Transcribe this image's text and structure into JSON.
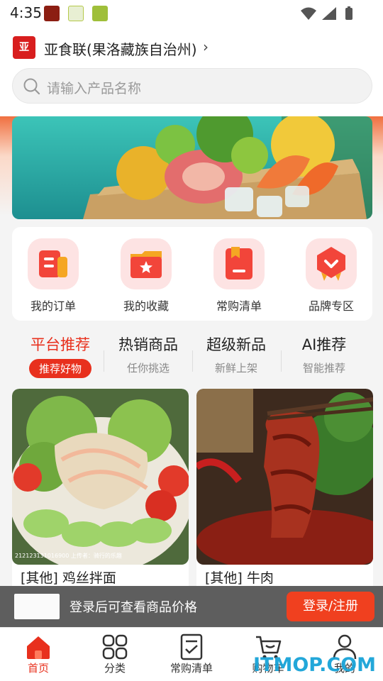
{
  "status_bar": {
    "time": "4:35"
  },
  "header": {
    "logo_text": "亚",
    "store_name": "亚食联(果洛藏族自治州)",
    "chevron": "›"
  },
  "search": {
    "placeholder": "请输入产品名称"
  },
  "quick_menu": [
    {
      "label": "我的订单",
      "icon": "order-icon"
    },
    {
      "label": "我的收藏",
      "icon": "favorite-folder-icon"
    },
    {
      "label": "常购清单",
      "icon": "list-book-icon"
    },
    {
      "label": "品牌专区",
      "icon": "brand-badge-icon"
    }
  ],
  "tabs": [
    {
      "title": "平台推荐",
      "sub": "推荐好物",
      "active": true
    },
    {
      "title": "热销商品",
      "sub": "任你挑选"
    },
    {
      "title": "超级新品",
      "sub": "新鲜上架"
    },
    {
      "title": "AI推荐",
      "sub": "智能推荐"
    }
  ],
  "products": [
    {
      "name": "[其他] 鸡丝拌面",
      "image_caption": "212123131016900 上传者：骑行的乐趣"
    },
    {
      "name": "[其他] 牛肉"
    }
  ],
  "login_bar": {
    "message": "登录后可查看商品价格",
    "button": "登录/注册"
  },
  "bottom_nav": [
    {
      "label": "首页",
      "icon": "home-icon",
      "active": true
    },
    {
      "label": "分类",
      "icon": "category-icon"
    },
    {
      "label": "常购清单",
      "icon": "list-icon"
    },
    {
      "label": "购物车",
      "icon": "cart-icon"
    },
    {
      "label": "我的",
      "icon": "profile-icon"
    }
  ],
  "watermark": "ITMOP.COM",
  "colors": {
    "accent": "#e8301d",
    "login_bar": "#5e5e5e",
    "login_button": "#f0401f"
  }
}
